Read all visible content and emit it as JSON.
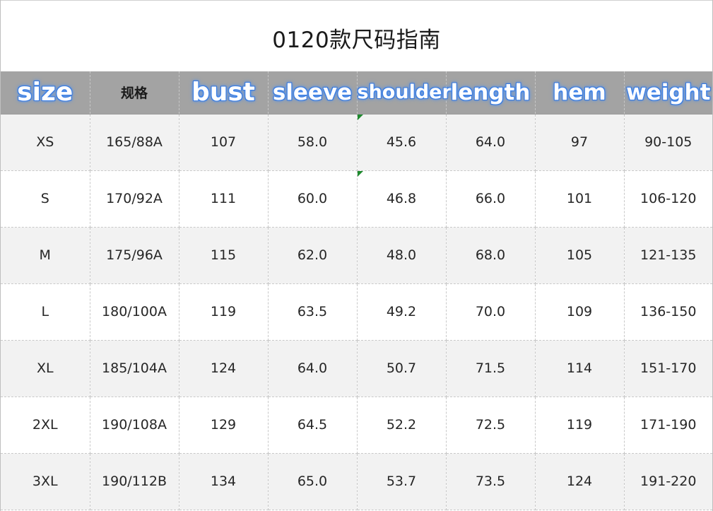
{
  "title": "0120款尺码指南",
  "columns": [
    "size",
    "规格",
    "bust",
    "sleeve",
    "shoulder",
    "length",
    "hem",
    "weight"
  ],
  "rows": [
    [
      "XS",
      "165/88A",
      "107",
      "58.0",
      "45.6",
      "64.0",
      "97",
      "90-105"
    ],
    [
      "S",
      "170/92A",
      "111",
      "60.0",
      "46.8",
      "66.0",
      "101",
      "106-120"
    ],
    [
      "M",
      "175/96A",
      "115",
      "62.0",
      "48.0",
      "68.0",
      "105",
      "121-135"
    ],
    [
      "L",
      "180/100A",
      "119",
      "63.5",
      "49.2",
      "70.0",
      "109",
      "136-150"
    ],
    [
      "XL",
      "185/104A",
      "124",
      "64.0",
      "50.7",
      "71.5",
      "114",
      "151-170"
    ],
    [
      "2XL",
      "190/108A",
      "129",
      "64.5",
      "52.2",
      "72.5",
      "119",
      "171-190"
    ],
    [
      "3XL",
      "190/112B",
      "134",
      "65.0",
      "53.7",
      "73.5",
      "124",
      "191-220"
    ]
  ],
  "colors": {
    "header_bg": "#a3a3a3",
    "row_shade": "#f2f2f2",
    "glow_blue": "#3a7fe8",
    "comment_marker": "#1e8a2e"
  }
}
